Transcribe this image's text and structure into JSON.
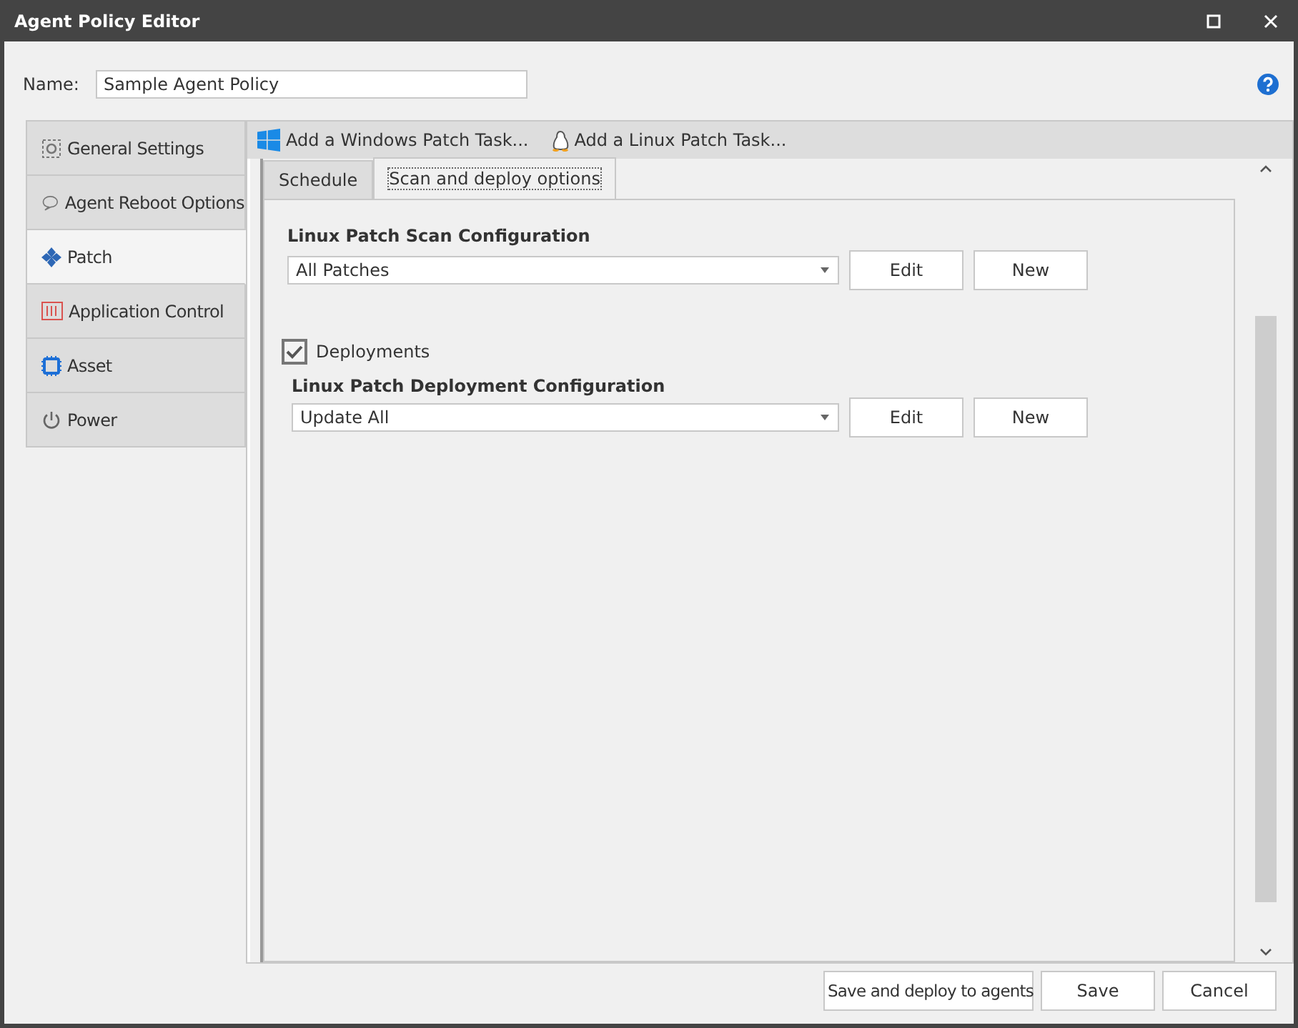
{
  "window": {
    "title": "Agent Policy Editor"
  },
  "name_field": {
    "label": "Name:",
    "value": "Sample Agent Policy"
  },
  "sidebar": {
    "items": [
      {
        "label": "General Settings",
        "selected": false
      },
      {
        "label": "Agent Reboot Options",
        "selected": false
      },
      {
        "label": "Patch",
        "selected": true
      },
      {
        "label": "Application Control",
        "selected": false
      },
      {
        "label": "Asset",
        "selected": false
      },
      {
        "label": "Power",
        "selected": false
      }
    ]
  },
  "toolbar": [
    "Add a Windows Patch Task...",
    "Add a Linux Patch Task..."
  ],
  "tabs": [
    {
      "label": "Schedule",
      "selected": false
    },
    {
      "label": "Scan and deploy options",
      "selected": true
    }
  ],
  "scan": {
    "heading": "Linux Patch Scan Configuration",
    "value": "All Patches",
    "buttons": [
      "Edit",
      "New"
    ]
  },
  "deployments": {
    "label": "Deployments",
    "checked": true
  },
  "deploy": {
    "heading": "Linux Patch Deployment Configuration",
    "value": "Update All",
    "buttons": [
      "Edit",
      "New"
    ]
  },
  "footer_buttons": [
    "Save and deploy to agents",
    "Save",
    "Cancel"
  ]
}
